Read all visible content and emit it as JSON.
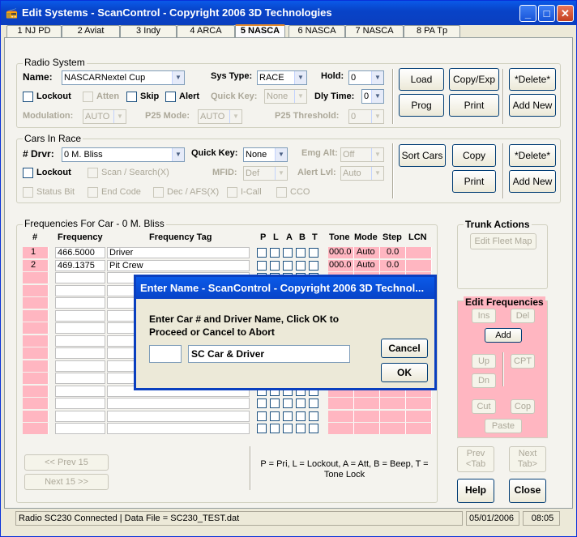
{
  "window": {
    "title": "Edit Systems - ScanControl - Copyright 2006 3D Technologies"
  },
  "tabs": [
    "1 NJ PD",
    "2 Aviat",
    "3 Indy",
    "4 ARCA",
    "5 NASCA",
    "6 NASCA",
    "7 NASCA",
    "8 PA Tp"
  ],
  "radio_system": {
    "label": "Radio System",
    "name_label": "Name:",
    "name_value": "NASCARNextel Cup",
    "sys_type_label": "Sys Type:",
    "sys_type_value": "RACE",
    "hold_label": "Hold:",
    "hold_value": "0",
    "lockout": "Lockout",
    "atten": "Atten",
    "skip": "Skip",
    "alert": "Alert",
    "quick_key_label": "Quick Key:",
    "quick_key_value": "None",
    "dly_time_label": "Dly Time:",
    "dly_time_value": "0",
    "modulation_label": "Modulation:",
    "modulation_value": "AUTO",
    "p25_mode_label": "P25 Mode:",
    "p25_mode_value": "AUTO",
    "p25_threshold_label": "P25 Threshold:",
    "p25_threshold_value": "0",
    "buttons": {
      "load": "Load",
      "copy_exp": "Copy/Exp",
      "delete": "*Delete*",
      "prog": "Prog",
      "print": "Print",
      "add_new": "Add New"
    }
  },
  "cars_in_race": {
    "label": "Cars In Race",
    "drvr_label": "# Drvr:",
    "drvr_value": "0  M. Bliss",
    "quick_key_label": "Quick Key:",
    "quick_key_value": "None",
    "emg_alt_label": "Emg Alt:",
    "emg_alt_value": "Off",
    "lockout": "Lockout",
    "scan_search": "Scan / Search(X)",
    "mfid_label": "MFID:",
    "mfid_value": "Def",
    "alert_lvl_label": "Alert Lvl:",
    "alert_lvl_value": "Auto",
    "status_bit": "Status Bit",
    "end_code": "End Code",
    "dec_afs": "Dec / AFS(X)",
    "i_call": "I-Call",
    "cco": "CCO",
    "buttons": {
      "sort_cars": "Sort Cars",
      "copy": "Copy",
      "delete": "*Delete*",
      "print": "Print",
      "add_new": "Add New"
    }
  },
  "frequencies": {
    "label": "Frequencies For Car - 0    M. Bliss",
    "headers": {
      "num": "#",
      "freq": "Frequency",
      "tag": "Frequency Tag",
      "p": "P",
      "l": "L",
      "a": "A",
      "b": "B",
      "t": "T",
      "tone": "Tone",
      "mode": "Mode",
      "step": "Step",
      "lcn": "LCN"
    },
    "rows": [
      {
        "num": "1",
        "freq": "466.5000",
        "tag": "Driver",
        "tone": "000.0",
        "mode": "Auto",
        "step": "0.0"
      },
      {
        "num": "2",
        "freq": "469.1375",
        "tag": "Pit Crew",
        "tone": "000.0",
        "mode": "Auto",
        "step": "0.0"
      }
    ],
    "prev": "<< Prev 15",
    "next": "Next 15 >>",
    "legend": "P = Pri, L = Lockout, A = Att, B = Beep, T = Tone Lock"
  },
  "trunk_actions": {
    "label": "Trunk Actions",
    "edit_fleet_map": "Edit Fleet Map"
  },
  "edit_frequencies": {
    "label": "Edit Frequencies",
    "ins": "Ins",
    "del": "Del",
    "add": "Add",
    "up": "Up",
    "dn": "Dn",
    "cpt": "CPT",
    "cut": "Cut",
    "cop": "Cop",
    "paste": "Paste"
  },
  "nav": {
    "prev_tab": "Prev <Tab",
    "next_tab": "Next Tab>",
    "help": "Help",
    "close": "Close"
  },
  "dialog": {
    "title": "Enter Name - ScanControl - Copyright 2006 3D Technol...",
    "message": "Enter Car # and Driver Name, Click OK to Proceed or Cancel to Abort",
    "car_value": "",
    "name_value": "SC Car & Driver",
    "cancel": "Cancel",
    "ok": "OK"
  },
  "status": {
    "message": "Radio SC230 Connected | Data File = SC230_TEST.dat",
    "date": "05/01/2006",
    "time": "08:05"
  }
}
